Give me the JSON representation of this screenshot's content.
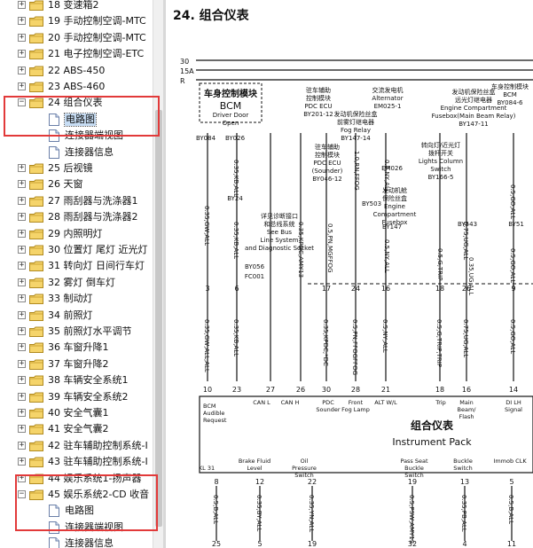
{
  "sidebar": {
    "items": [
      {
        "label": "18 变速箱2",
        "kind": "folder"
      },
      {
        "label": "19 手动控制空调-MTC",
        "kind": "folder"
      },
      {
        "label": "20 手动控制空调-MTC",
        "kind": "folder"
      },
      {
        "label": "21 电子控制空调-ETC",
        "kind": "folder"
      },
      {
        "label": "22 ABS-450",
        "kind": "folder"
      },
      {
        "label": "23 ABS-460",
        "kind": "folder"
      },
      {
        "label": "24 组合仪表",
        "kind": "folder",
        "expanded": true
      },
      {
        "label": "电路图",
        "kind": "page",
        "selected": true
      },
      {
        "label": "连接器端视图",
        "kind": "page"
      },
      {
        "label": "连接器信息",
        "kind": "page"
      },
      {
        "label": "25 后视镜",
        "kind": "folder"
      },
      {
        "label": "26 天窗",
        "kind": "folder"
      },
      {
        "label": "27 雨刮器与洗涤器1",
        "kind": "folder"
      },
      {
        "label": "28 雨刮器与洗涤器2",
        "kind": "folder"
      },
      {
        "label": "29 内照明灯",
        "kind": "folder"
      },
      {
        "label": "30 位置灯 尾灯 近光灯",
        "kind": "folder"
      },
      {
        "label": "31 转向灯 日间行车灯",
        "kind": "folder"
      },
      {
        "label": "32 雾灯 倒车灯",
        "kind": "folder"
      },
      {
        "label": "33 制动灯",
        "kind": "folder"
      },
      {
        "label": "34 前照灯",
        "kind": "folder"
      },
      {
        "label": "35 前照灯水平调节",
        "kind": "folder"
      },
      {
        "label": "36 车窗升降1",
        "kind": "folder"
      },
      {
        "label": "37 车窗升降2",
        "kind": "folder"
      },
      {
        "label": "38 车辆安全系统1",
        "kind": "folder"
      },
      {
        "label": "39 车辆安全系统2",
        "kind": "folder"
      },
      {
        "label": "40 安全气囊1",
        "kind": "folder"
      },
      {
        "label": "41 安全气囊2",
        "kind": "folder"
      },
      {
        "label": "42 驻车辅助控制系统-I",
        "kind": "folder"
      },
      {
        "label": "43 驻车辅助控制系统-I",
        "kind": "folder"
      },
      {
        "label": "44 娱乐系统1-扬声器",
        "kind": "folder"
      },
      {
        "label": "45 娱乐系统2-CD 收音",
        "kind": "folder",
        "expanded": true
      },
      {
        "label": "电路图",
        "kind": "page"
      },
      {
        "label": "连接器端视图",
        "kind": "page"
      },
      {
        "label": "连接器信息",
        "kind": "page"
      }
    ]
  },
  "document": {
    "heading": "24.  组合仪表",
    "rails": [
      "30",
      "15A",
      "R"
    ],
    "bcm_box": {
      "title_cn": "车身控制模块",
      "title_en": "BCM",
      "sub1": "Driver Door",
      "sub2": "Open"
    },
    "top_labels": [
      {
        "id": "pdc_top",
        "lines": [
          "驻车辅助",
          "控制模块",
          "PDC ECU",
          "BY201-12"
        ]
      },
      {
        "id": "alt",
        "lines": [
          "交流发电机",
          "Alternator",
          "EM025-1"
        ]
      },
      {
        "id": "fog",
        "lines": [
          "发动机保险丝盒",
          "前雾灯继电器",
          "Fog Relay",
          "BY147-14"
        ]
      },
      {
        "id": "main_beam",
        "lines": [
          "发动机保险丝盒",
          "远光灯继电器",
          "Engine Compartment",
          "Fusebox(Main Beam Relay)",
          "BY147-11"
        ]
      },
      {
        "id": "bcm_right",
        "lines": [
          "车身控制模块",
          "BCM",
          "BY084-6"
        ]
      },
      {
        "id": "pdc_sounder",
        "lines": [
          "驻车辅助",
          "控制模块",
          "PDC ECU",
          "(Sounder)",
          "BY046-12"
        ]
      },
      {
        "id": "lights_column",
        "lines": [
          "转向灯/近光灯",
          "拨杆开关",
          "Lights Column",
          "Switch",
          "BY166-5"
        ]
      },
      {
        "id": "ecf",
        "lines": [
          "发动机舱",
          "保险丝盒",
          "Engine",
          "Compartment",
          "Fusebox"
        ]
      },
      {
        "id": "diag",
        "lines": [
          "详见诊断接口",
          "和总线系统",
          "See Bus",
          "Line System",
          "and Diagnostic Socket"
        ]
      }
    ],
    "connector_labels": [
      "BY084",
      "BY026",
      "BY24",
      "BY056",
      "FC001",
      "EM026",
      "BY503",
      "BY147",
      "BY543",
      "BY51"
    ],
    "wire_codes_upper": [
      "0.35,GW,ALL",
      "0.35,KB,ALL",
      "0.35,KB,ALL",
      "0.35,KPDC,AMY13",
      "0.5,PN,MGFFOG",
      "1.0,RN,FFOG",
      "0.5,NY,ALL",
      "0.5,G,TRIP",
      "0.75,UG,ALL",
      "0.5,GO,ALL",
      "0.35,UG,ALL",
      "0.5,NY,ALL",
      "0.5,GO,ALL"
    ],
    "pin_row_top": [
      "3",
      "6",
      "17",
      "24",
      "16",
      "18",
      "26",
      "9"
    ],
    "wire_codes_middle": [
      "0.35,GW,ALL,ALL",
      "0.35,KB,ALL",
      "0.35,KPDC,*DC",
      "0.5,PN,FFOGFFOG",
      "0.5,NY,ALL",
      "0.5,G,TRIP,TRIP",
      "0.75,UG,ALL",
      "0.5,GO,ALL"
    ],
    "cluster_pins": [
      "10",
      "23",
      "27",
      "26",
      "30",
      "28",
      "21",
      "18",
      "16",
      "14"
    ],
    "cluster_signals": [
      "BCM Audible Request",
      "CAN L",
      "CAN H",
      "PDC Sounder",
      "Front Fog Lamp",
      "ALT W/L",
      "Trip",
      "Main Beam/ Flash",
      "DI LH Signal"
    ],
    "cluster_title_cn": "组合仪表",
    "cluster_title_en": "Instrument Pack",
    "cluster_bottom_signals": [
      "KL 31",
      "Brake Fluid Level",
      "Oil Pressure Switch",
      "Pass Seat Buckle Switch",
      "Buckle Switch",
      "Immob CLK"
    ],
    "lower_pins": [
      "8",
      "12",
      "22",
      "19",
      "13",
      "5"
    ],
    "wire_codes_lower": [
      "0.5,B,ALL",
      "0.35,BY,ALL",
      "0.35,YN,ALL",
      "0.5,PSW,AMY13",
      "0.35,PB,ALL",
      "0.5,B,ALL"
    ],
    "bottom_pins": [
      "25",
      "5",
      "19",
      "32",
      "4",
      "11"
    ]
  }
}
